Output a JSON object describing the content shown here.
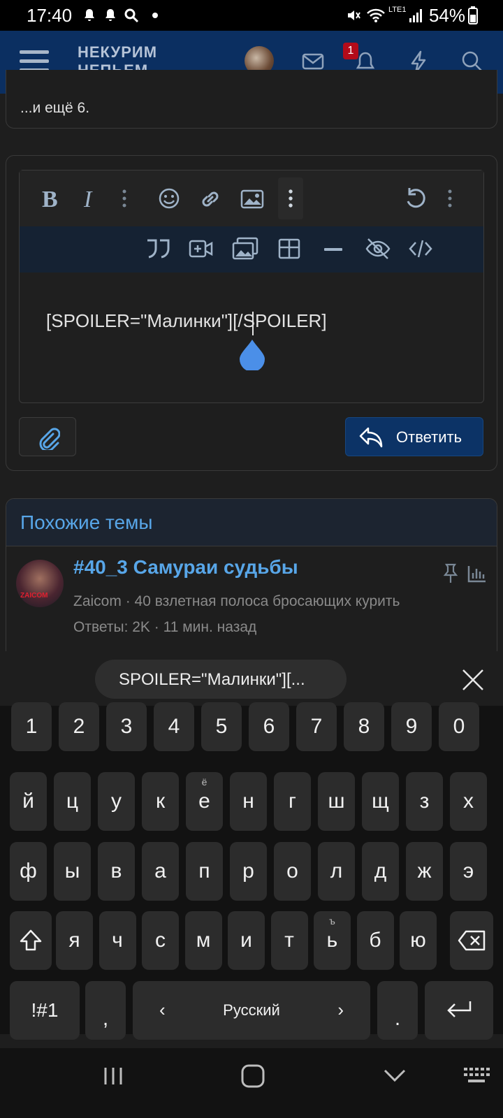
{
  "status_bar": {
    "time": "17:40",
    "battery": "54%",
    "network": "LTE1"
  },
  "header": {
    "logo_line1": "НЕКУРИМ",
    "logo_line2": "НЕПЬЕМ...",
    "notification_count": "1"
  },
  "prev_panel": {
    "more_text": "...и ещё 6."
  },
  "editor": {
    "text": "[SPOILER=\"Малинки\"][/SPOILER]",
    "toolbar_row1": [
      "bold-icon",
      "italic-icon",
      "more-icon",
      "smiley-icon",
      "link-icon",
      "image-icon",
      "more-icon",
      "undo-icon",
      "more-icon"
    ],
    "toolbar_row2": [
      "quote-icon",
      "video-icon",
      "gallery-icon",
      "table-icon",
      "hr-icon",
      "spoiler-hide-icon",
      "code-icon"
    ]
  },
  "reply": {
    "label": "Ответить"
  },
  "similar": {
    "title": "Похожие темы",
    "thread": {
      "title": "#40_3 Самураи судьбы",
      "author": "Zaicom",
      "forum": "40 взлетная полоса бросающих курить",
      "meta": "Ответы: 2K · 11 мин. назад",
      "avatar_text": "ZAICOM"
    }
  },
  "suggestion": {
    "text": "SPOILER=\"Малинки\"][..."
  },
  "keyboard": {
    "numbers": [
      "1",
      "2",
      "3",
      "4",
      "5",
      "6",
      "7",
      "8",
      "9",
      "0"
    ],
    "row1": [
      "й",
      "ц",
      "у",
      "к",
      "е",
      "н",
      "г",
      "ш",
      "щ",
      "з",
      "х"
    ],
    "row1_hints": [
      "",
      "",
      "",
      "",
      "ё",
      "",
      "",
      "",
      "",
      "",
      ""
    ],
    "row2": [
      "ф",
      "ы",
      "в",
      "а",
      "п",
      "р",
      "о",
      "л",
      "д",
      "ж",
      "э"
    ],
    "row3": [
      "я",
      "ч",
      "с",
      "м",
      "и",
      "т",
      "ь",
      "б",
      "ю"
    ],
    "row3_hints": [
      "",
      "",
      "",
      "",
      "",
      "",
      "ъ",
      "",
      ""
    ],
    "symbols_label": "!#1",
    "comma": ",",
    "period": ".",
    "language_label": "Русский"
  },
  "colors": {
    "accent": "#58a6e8",
    "header_bg": "#0b2f61",
    "badge": "#b30b1a"
  }
}
